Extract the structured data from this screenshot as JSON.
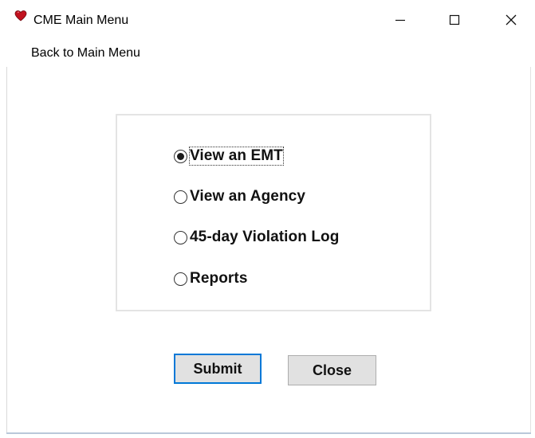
{
  "window": {
    "title": "CME Main Menu",
    "icon": "heart-icon",
    "controls": [
      "minimize-icon",
      "maximize-icon",
      "close-icon"
    ]
  },
  "menubar": {
    "items": [
      {
        "label": "Back to Main Menu"
      }
    ]
  },
  "options": {
    "selected": "View an EMT",
    "items": [
      {
        "label": "View an EMT",
        "checked": true
      },
      {
        "label": "View an Agency",
        "checked": false
      },
      {
        "label": "45-day Violation Log",
        "checked": false
      },
      {
        "label": "Reports",
        "checked": false
      }
    ]
  },
  "buttons": {
    "submit_label": "Submit",
    "close_label": "Close"
  },
  "colors": {
    "accent": "#0078d7",
    "icon_red": "#c1121f",
    "button_face": "#e1e1e1"
  }
}
